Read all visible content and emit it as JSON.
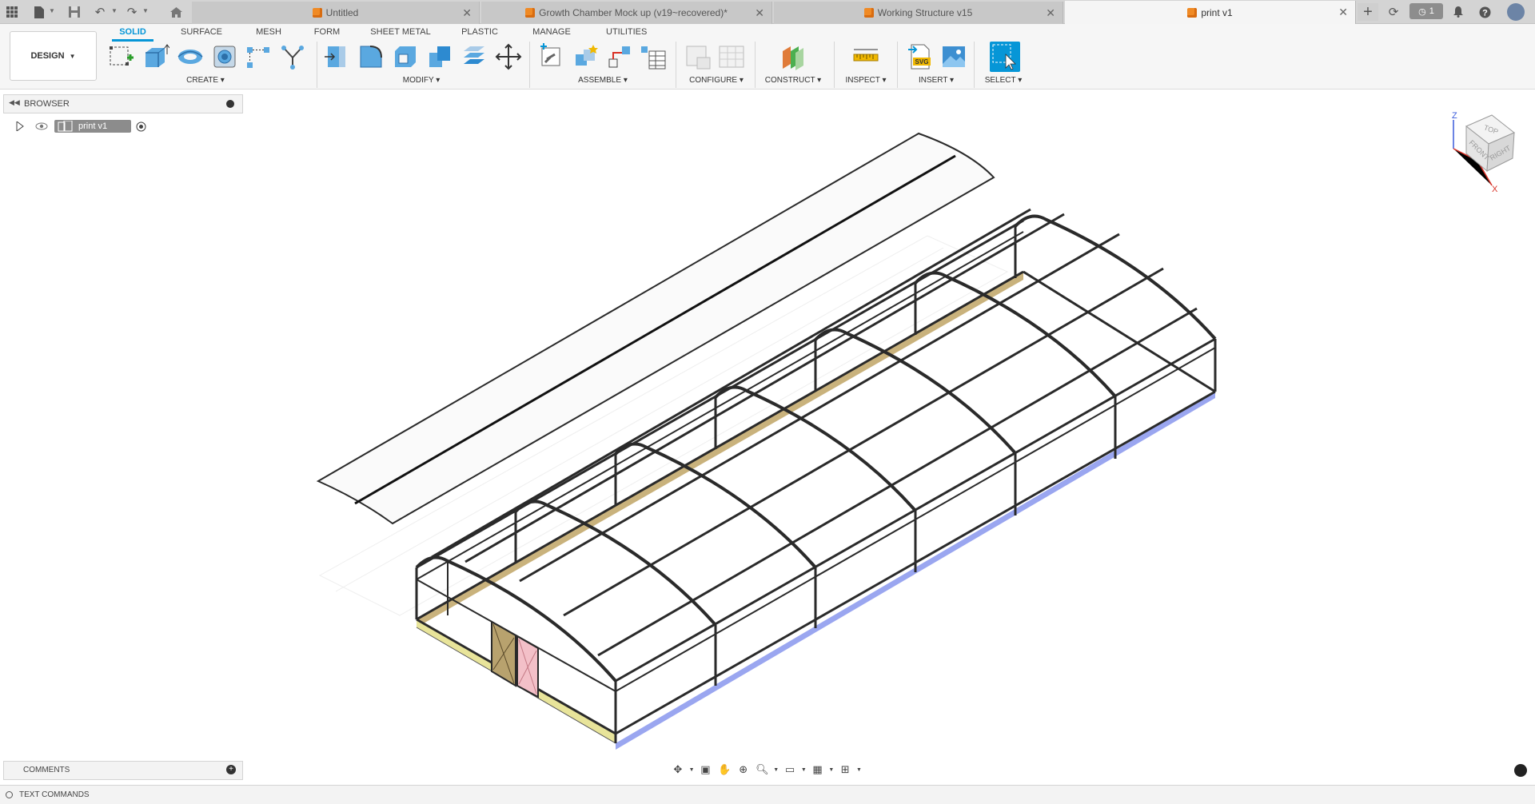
{
  "tabs": [
    {
      "label": "Untitled",
      "active": false
    },
    {
      "label": "Growth Chamber Mock up (v19~recovered)*",
      "active": false
    },
    {
      "label": "Working Structure v15",
      "active": false
    },
    {
      "label": "print v1",
      "active": true
    }
  ],
  "job_status_count": "1",
  "workspace": {
    "label": "DESIGN"
  },
  "ribbon_tabs": [
    "SOLID",
    "SURFACE",
    "MESH",
    "FORM",
    "SHEET METAL",
    "PLASTIC",
    "MANAGE",
    "UTILITIES"
  ],
  "ribbon_groups": {
    "create": "CREATE",
    "modify": "MODIFY",
    "assemble": "ASSEMBLE",
    "configure": "CONFIGURE",
    "construct": "CONSTRUCT",
    "inspect": "INSPECT",
    "insert": "INSERT",
    "select": "SELECT"
  },
  "browser": {
    "title": "BROWSER",
    "root_item": "print v1"
  },
  "viewcube": {
    "top": "TOP",
    "front": "FRONT",
    "right": "RIGHT",
    "axis_z": "Z",
    "axis_x": "X"
  },
  "comments": {
    "label": "COMMENTS"
  },
  "text_commands": {
    "label": "TEXT COMMANDS"
  },
  "colors": {
    "accent": "#0696d7",
    "tab_icon": "#f08a24",
    "frame": "#2a2a2a",
    "base_wood": "#c9b27c",
    "base_blue": "#9aa6f0"
  }
}
